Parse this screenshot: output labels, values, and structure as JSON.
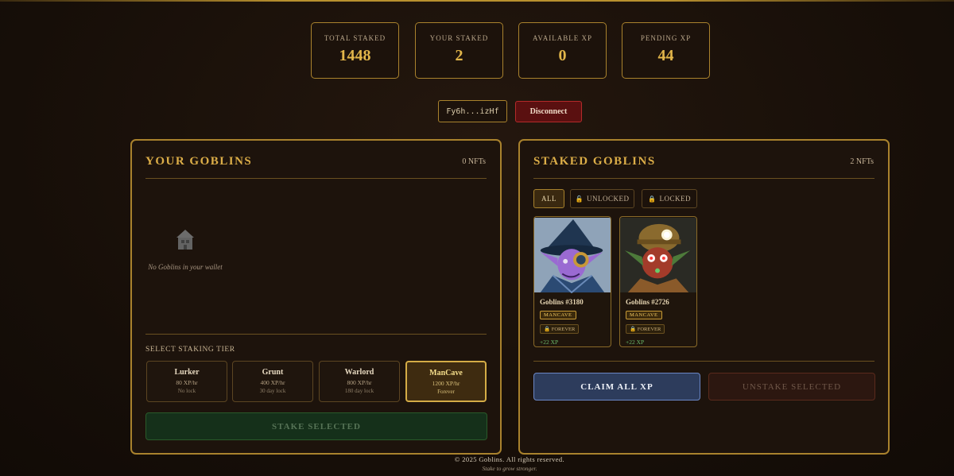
{
  "stats": [
    {
      "label": "TOTAL STAKED",
      "value": "1448"
    },
    {
      "label": "YOUR STAKED",
      "value": "2"
    },
    {
      "label": "AVAILABLE XP",
      "value": "0"
    },
    {
      "label": "PENDING XP",
      "value": "44"
    }
  ],
  "wallet": {
    "address": "Fy6h...izHf",
    "disconnect_label": "Disconnect"
  },
  "your_goblins": {
    "title": "YOUR GOBLINS",
    "count": "0 NFTs",
    "empty_icon": "house-icon",
    "empty_text": "No Goblins in your wallet",
    "tier_label": "SELECT STAKING TIER",
    "tiers": [
      {
        "name": "Lurker",
        "rate": "80 XP/hr",
        "lock": "No lock"
      },
      {
        "name": "Grunt",
        "rate": "400 XP/hr",
        "lock": "30 day lock"
      },
      {
        "name": "Warlord",
        "rate": "800 XP/hr",
        "lock": "180 day lock"
      },
      {
        "name": "ManCave",
        "rate": "1200 XP/hr",
        "lock": "Forever"
      }
    ],
    "selected_tier": "ManCave",
    "stake_label": "STAKE SELECTED"
  },
  "staked_goblins": {
    "title": "STAKED GOBLINS",
    "count": "2 NFTs",
    "filters": [
      "ALL",
      "UNLOCKED",
      "LOCKED"
    ],
    "active_filter": "ALL",
    "cards": [
      {
        "name": "Goblins #3180",
        "tier": "MANCAVE",
        "lock": "FOREVER",
        "xp": "+22 XP"
      },
      {
        "name": "Goblins #2726",
        "tier": "MANCAVE",
        "lock": "FOREVER",
        "xp": "+22 XP"
      }
    ],
    "claim_label": "CLAIM ALL XP",
    "unstake_label": "UNSTAKE SELECTED"
  },
  "footer": {
    "copyright": "© 2025 Goblins. All rights reserved.",
    "tagline": "Stake to grow stronger."
  },
  "colors": {
    "accent": "#a9822d",
    "gold_text": "#dcae48",
    "claim": "#2d3c5c",
    "disconnect": "#5a1010"
  }
}
